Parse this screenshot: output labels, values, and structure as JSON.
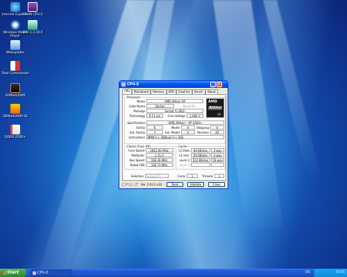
{
  "desktop": {
    "icons": [
      {
        "label": "Internet Explorer",
        "icon": "internet-explorer-icon"
      },
      {
        "label": "CPUID CPU-Z",
        "icon": "cpuz-icon"
      },
      {
        "label": "Windows Media Player",
        "icon": "media-player-icon"
      },
      {
        "label": "SPD 2.3.10.0",
        "icon": "spd-icon"
      },
      {
        "label": "Webupdate",
        "icon": "webupdate-icon"
      },
      {
        "label": "Total Commander",
        "icon": "total-commander-icon"
      },
      {
        "label": "3DMark2000",
        "icon": "3dmark-icon"
      },
      {
        "label": "3DMark2000 SE",
        "icon": "3dmark-se-icon"
      },
      {
        "label": "DDOS 2500+",
        "icon": "document-icon"
      }
    ]
  },
  "window": {
    "title": "CPU-Z",
    "buttons": {
      "min": "_",
      "max": "□",
      "close": "×"
    },
    "tabs": [
      "CPU",
      "Mainboard",
      "Memory",
      "SPD",
      "Graphics",
      "Bench",
      "About"
    ],
    "active_tab": "CPU",
    "processor": {
      "legend": "Processor",
      "name_label": "Name",
      "name": "AMD Athlon XP",
      "codename_label": "Code Name",
      "codename": "Barton",
      "brand_id_label": "Brand ID",
      "package_label": "Package",
      "package": "Socket A (462)",
      "technology_label": "Technology",
      "technology": "0.13 um",
      "core_voltage_label": "Core Voltage",
      "core_voltage": "1.664 V",
      "spec_label": "Specification",
      "spec": "AMD Athlon™ XP 2500+",
      "family_label": "Family",
      "family": "6",
      "model_label": "Model",
      "model": "A",
      "stepping_label": "Stepping",
      "stepping": "0",
      "ext_family_label": "Ext. Family",
      "ext_family": "7",
      "ext_model_label": "Ext. Model",
      "ext_model": "A",
      "revision_label": "Revision",
      "revision": "AZ",
      "instructions_label": "Instructions",
      "instructions": "MMX(+), 3DNow!(+), SSE"
    },
    "logo": {
      "brand": "AMD",
      "product": "Athlon",
      "sub": "XP"
    },
    "clocks": {
      "legend": "Clocks (Core #0)",
      "core_speed_label": "Core Speed",
      "core_speed": "1852.00 MHz",
      "multiplier_label": "Multiplier",
      "multiplier": "x 11.0",
      "bus_speed_label": "Bus Speed",
      "bus_speed": "168.36 MHz",
      "rated_fsb_label": "Rated FSB",
      "rated_fsb": "336.73 MHz"
    },
    "cache": {
      "legend": "Cache",
      "l1d_label": "L1 Data",
      "l1d": "64 KBytes",
      "l1d_way": "2-way",
      "l1i_label": "L1 Inst.",
      "l1i": "64 KBytes",
      "l1i_way": "2-way",
      "l2_label": "Level 2",
      "l2": "512 KBytes",
      "l2_way": "16-way",
      "l3_label": "Level 3"
    },
    "selection_label": "Selection",
    "selection": "Socket #1",
    "cores_label": "Cores",
    "cores": "1",
    "threads_label": "Threads",
    "threads": "1",
    "brand": "CPU-Z",
    "version": "Ver. 2.03.1.x32",
    "tools_label": "Tools",
    "validate_label": "Validate",
    "close_label": "Close"
  },
  "taskbar": {
    "start_label": "Start",
    "task_label": "CPU-Z",
    "lang": "EN",
    "clock": "15:51"
  }
}
